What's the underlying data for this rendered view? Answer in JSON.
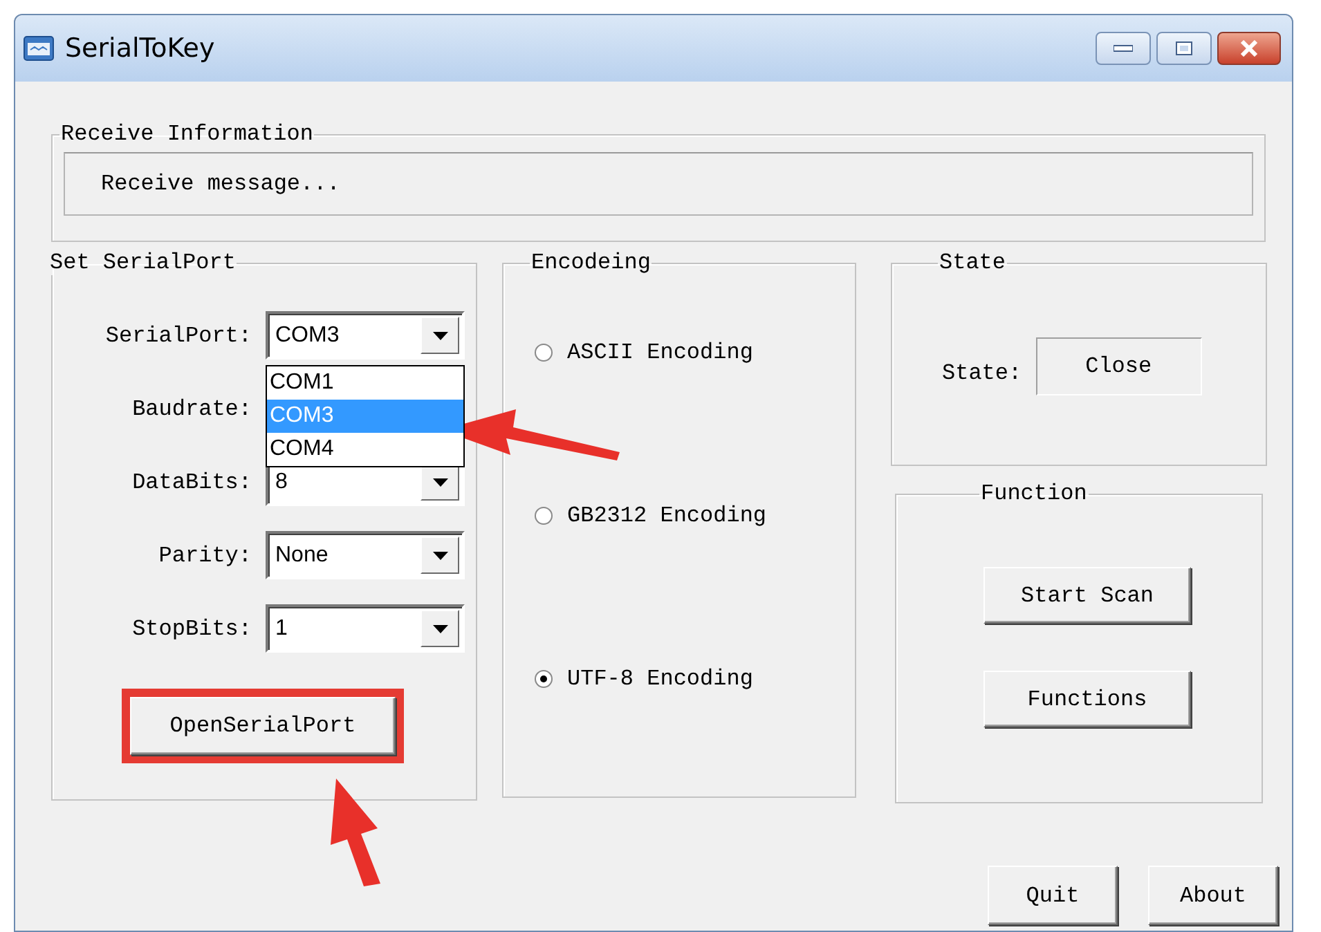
{
  "window": {
    "title": "SerialToKey"
  },
  "receive_information": {
    "title": "Receive Information",
    "message": "Receive message..."
  },
  "serial_port": {
    "title": "Set SerialPort",
    "fields": [
      {
        "label": "SerialPort:",
        "value": "COM3",
        "expanded": true,
        "options": [
          {
            "label": "COM1",
            "selected": false
          },
          {
            "label": "COM3",
            "selected": true
          },
          {
            "label": "COM4",
            "selected": false
          }
        ]
      },
      {
        "label": "Baudrate:"
      },
      {
        "label": "DataBits:",
        "value": "8"
      },
      {
        "label": "Parity:",
        "value": "None"
      },
      {
        "label": "StopBits:",
        "value": "1"
      }
    ],
    "button": {
      "label": "OpenSerialPort",
      "highlighted": true
    }
  },
  "encoding": {
    "title": "Encodeing",
    "options": [
      {
        "label": "ASCII Encoding",
        "selected": false
      },
      {
        "label": "GB2312 Encoding",
        "selected": false
      },
      {
        "label": "UTF-8 Encoding",
        "selected": true
      }
    ]
  },
  "state": {
    "title": "State",
    "label": "State:",
    "value": "Close"
  },
  "function": {
    "title": "Function",
    "buttons": [
      "Start Scan",
      "Functions"
    ]
  },
  "buttons": [
    "Quit",
    "About"
  ]
}
